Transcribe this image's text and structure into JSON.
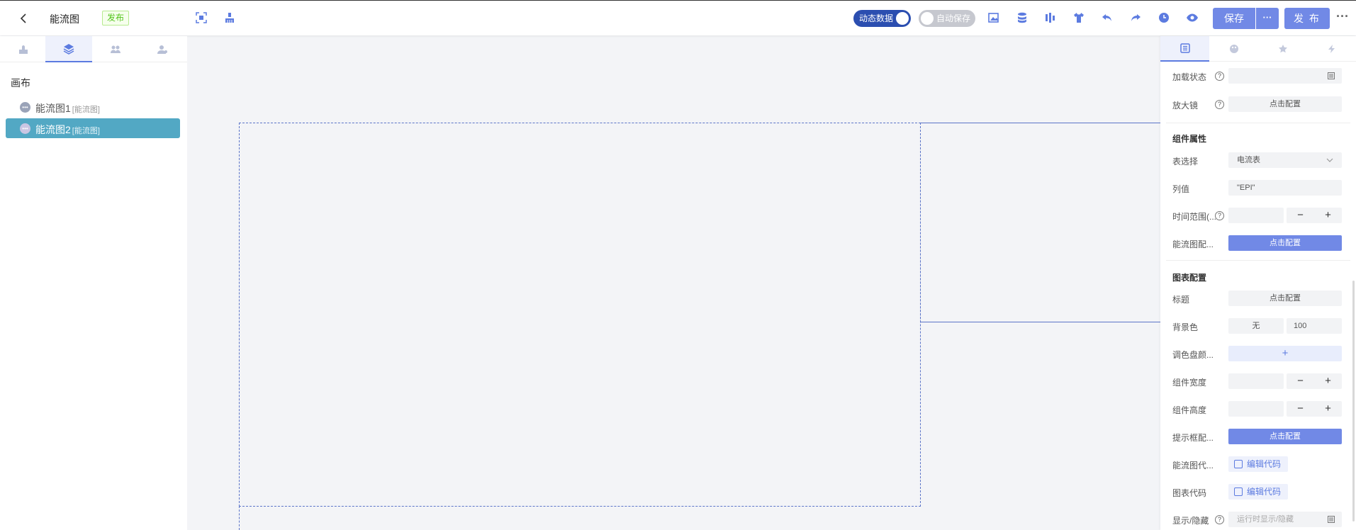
{
  "header": {
    "title": "能流图",
    "status_tag": "发布",
    "dynamic_data_label": "动态数据",
    "auto_save_label": "自动保存",
    "save_label": "保存",
    "save_more": "···",
    "publish_label": "发 布",
    "more": "···"
  },
  "left_panel": {
    "canvas_label": "画布",
    "layers": [
      {
        "name": "能流图1",
        "type": "[能流图]",
        "active": false
      },
      {
        "name": "能流图2",
        "type": "[能流图]",
        "active": true
      }
    ]
  },
  "right_panel": {
    "loading_label": "加载状态",
    "magnifier_label": "放大镜",
    "magnifier_btn": "点击配置",
    "section_component": "组件属性",
    "table_select_label": "表选择",
    "table_select_value": "电流表",
    "column_label": "列值",
    "column_value": "\"EPI\"",
    "time_range_label": "时间范围(...",
    "flow_config_label": "能流图配...",
    "flow_config_btn": "点击配置",
    "section_chart": "图表配置",
    "chart_title_label": "标题",
    "chart_title_btn": "点击配置",
    "bg_color_label": "背景色",
    "bg_color_value": "无",
    "bg_opacity_value": "100",
    "palette_label": "调色盘颜...",
    "palette_add": "+",
    "width_label": "组件宽度",
    "height_label": "组件高度",
    "tooltip_label": "提示框配...",
    "tooltip_btn": "点击配置",
    "flow_code_label": "能流图代...",
    "flow_code_btn": "编辑代码",
    "chart_code_label": "图表代码",
    "chart_code_btn": "编辑代码",
    "visibility_label": "显示/隐藏",
    "visibility_placeholder": "运行时显示/隐藏",
    "minus": "−",
    "plus": "+"
  },
  "colors": {
    "accent": "#7189e6",
    "active_layer": "#52a8c4",
    "toggle_on": "#2b4eb0"
  }
}
